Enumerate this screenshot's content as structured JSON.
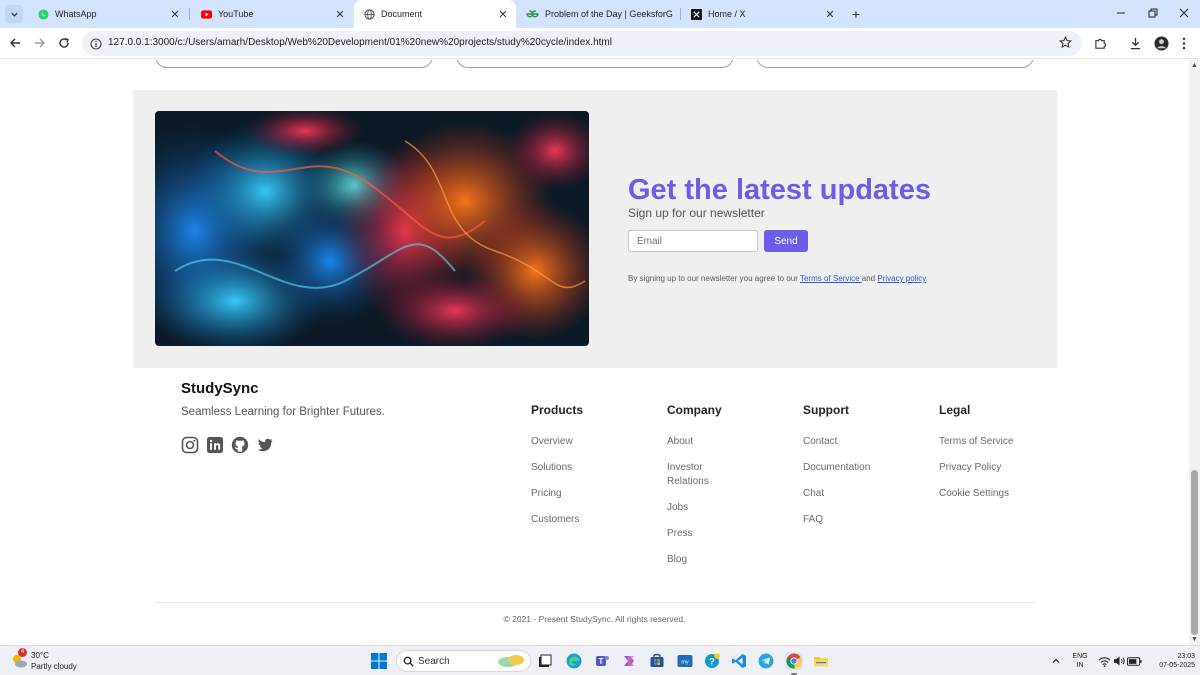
{
  "browser": {
    "tabs": [
      {
        "title": "WhatsApp",
        "icon": "whatsapp-icon",
        "active": false
      },
      {
        "title": "YouTube",
        "icon": "youtube-icon",
        "active": false
      },
      {
        "title": "Document",
        "icon": "globe-icon",
        "active": true
      },
      {
        "title": "Problem of the Day | GeeksforG",
        "icon": "geeksforgeeks-icon",
        "active": false
      },
      {
        "title": "Home / X",
        "icon": "x-icon",
        "active": false
      }
    ],
    "url": "127.0.0.1:3000/c:/Users/amarh/Desktop/Web%20Development/01%20new%20projects/study%20cycle/index.html"
  },
  "newsletter": {
    "heading": "Get the latest updates",
    "subheading": "Sign up for our newsletter",
    "email_placeholder": "Email",
    "send_label": "Send",
    "legal_prefix": "By signing up to our newsletter you agree to our ",
    "terms_link": "Terms of Service ",
    "legal_and": "and ",
    "privacy_link": "Privacy policy",
    "accent": "#6c5ce7"
  },
  "footer": {
    "brand": "StudySync",
    "tagline": "Seamless Learning for Brighter Futures.",
    "socials": [
      "instagram-icon",
      "linkedin-icon",
      "github-icon",
      "twitter-icon"
    ],
    "columns": [
      {
        "title": "Products",
        "links": [
          "Overview",
          "Solutions",
          "Pricing",
          "Customers"
        ]
      },
      {
        "title": "Company",
        "links": [
          "About",
          "Investor Relations",
          "Jobs",
          "Press",
          "Blog"
        ]
      },
      {
        "title": "Support",
        "links": [
          "Contact",
          "Documentation",
          "Chat",
          "FAQ"
        ]
      },
      {
        "title": "Legal",
        "links": [
          "Terms of Service",
          "Privacy Policy",
          "Cookie Settings"
        ]
      }
    ],
    "copyright": "© 2021 - Present StudySync. All rights reserved."
  },
  "taskbar": {
    "weather_temp": "30°C",
    "weather_cond": "Partly cloudy",
    "weather_badge": "4",
    "search_label": "Search",
    "lang_line1": "ENG",
    "lang_line2": "IN",
    "time": "23:03",
    "date": "07-05-2025"
  }
}
